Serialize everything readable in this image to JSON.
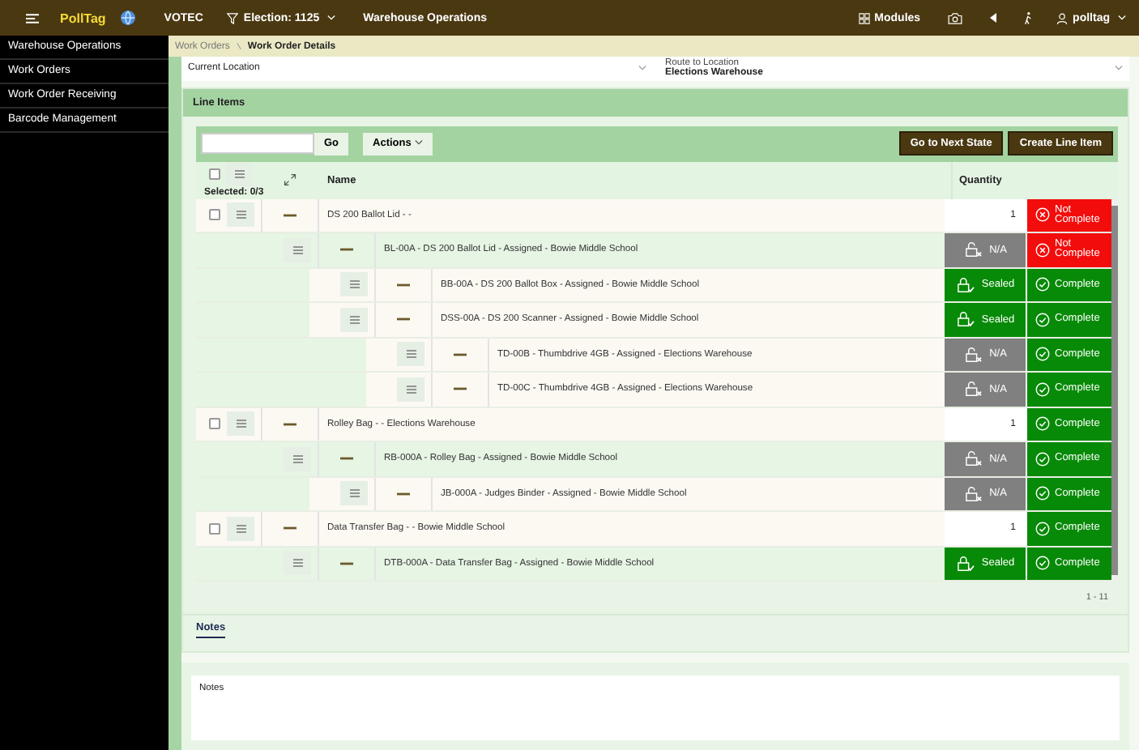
{
  "header": {
    "brand": "PollTag",
    "org": "VOTEC",
    "election": "Election: 1125",
    "section": "Warehouse Operations",
    "modules": "Modules",
    "user": "polltag"
  },
  "sidebar": {
    "items": [
      {
        "label": "Warehouse Operations"
      },
      {
        "label": "Work Orders"
      },
      {
        "label": "Work Order Receiving"
      },
      {
        "label": "Barcode Management"
      }
    ]
  },
  "breadcrumb": [
    {
      "label": "Work Orders"
    },
    {
      "label": "Work Order Details"
    }
  ],
  "location": {
    "current_label": "Current Location",
    "route_label": "Route to Location",
    "route_value": "Elections Warehouse"
  },
  "line_items": {
    "title": "Line Items",
    "go": "Go",
    "actions": "Actions",
    "next_state": "Go to Next State",
    "create": "Create Line Item",
    "select_all": {
      "checked": false
    },
    "columns": {
      "selected": "Selected: 0/3",
      "name": "Name",
      "quantity": "Quantity"
    },
    "rows": [
      {
        "name": "DS 200 Ballot Lid - -",
        "checked": false,
        "quantity": "1",
        "status": {
          "kind": "not_complete",
          "label": "Not Complete"
        },
        "children": [
          {
            "name": "BL-00A - DS 200 Ballot Lid - Assigned - Bowie Middle School",
            "seal": {
              "kind": "na",
              "label": "N/A"
            },
            "status": {
              "kind": "not_complete",
              "label": "Not Complete"
            },
            "children": [
              {
                "name": "BB-00A - DS 200 Ballot Box - Assigned - Bowie Middle School",
                "seal": {
                  "kind": "sealed",
                  "label": "Sealed"
                },
                "status": {
                  "kind": "complete",
                  "label": "Complete"
                }
              },
              {
                "name": "DSS-00A - DS 200 Scanner - Assigned - Bowie Middle School",
                "seal": {
                  "kind": "sealed",
                  "label": "Sealed"
                },
                "status": {
                  "kind": "complete",
                  "label": "Complete"
                },
                "children": [
                  {
                    "name": "TD-00B - Thumbdrive 4GB - Assigned - Elections Warehouse",
                    "seal": {
                      "kind": "na",
                      "label": "N/A"
                    },
                    "status": {
                      "kind": "complete",
                      "label": "Complete"
                    }
                  },
                  {
                    "name": "TD-00C - Thumbdrive 4GB - Assigned - Elections Warehouse",
                    "seal": {
                      "kind": "na",
                      "label": "N/A"
                    },
                    "status": {
                      "kind": "complete",
                      "label": "Complete"
                    }
                  }
                ]
              }
            ]
          }
        ]
      },
      {
        "name": "Rolley Bag - - Elections Warehouse",
        "checked": false,
        "quantity": "1",
        "status": {
          "kind": "complete",
          "label": "Complete"
        },
        "children": [
          {
            "name": "RB-000A - Rolley Bag - Assigned - Bowie Middle School",
            "seal": {
              "kind": "na",
              "label": "N/A"
            },
            "status": {
              "kind": "complete",
              "label": "Complete"
            },
            "children": [
              {
                "name": "JB-000A - Judges Binder - Assigned - Bowie Middle School",
                "seal": {
                  "kind": "na",
                  "label": "N/A"
                },
                "status": {
                  "kind": "complete",
                  "label": "Complete"
                }
              }
            ]
          }
        ]
      },
      {
        "name": "Data Transfer Bag - - Bowie Middle School",
        "checked": false,
        "quantity": "1",
        "status": {
          "kind": "complete",
          "label": "Complete"
        },
        "children": [
          {
            "name": "DTB-000A - Data Transfer Bag - Assigned - Bowie Middle School",
            "seal": {
              "kind": "sealed",
              "label": "Sealed"
            },
            "status": {
              "kind": "complete",
              "label": "Complete"
            }
          }
        ]
      }
    ],
    "pagination": "1 - 11"
  },
  "tabs": [
    {
      "label": "Notes",
      "selected": true
    }
  ],
  "notes": {
    "label": "Notes"
  }
}
